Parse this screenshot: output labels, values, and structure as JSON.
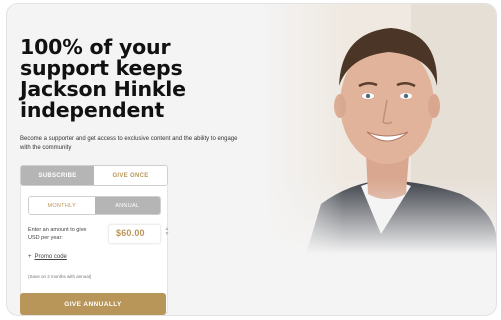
{
  "hero": {
    "headline": "100% of your support keeps Jackson Hinkle independent",
    "subtext": "Become a supporter and get access to exclusive content and the ability to engage with the community"
  },
  "tabs": [
    {
      "label": "SUBSCRIBE",
      "active": true
    },
    {
      "label": "GIVE ONCE",
      "active": false
    }
  ],
  "frequency": [
    {
      "label": "MONTHLY",
      "selected": false
    },
    {
      "label": "ANNUAL",
      "selected": true
    }
  ],
  "amount": {
    "label": "Enter an amount to give USD per year:",
    "value": "$60.00",
    "stepper_icon": "updown-chevron-icon"
  },
  "promo": {
    "plus": "+",
    "label": "Promo code"
  },
  "note": "(Save on 2 months with annual)",
  "cta": "GIVE ANNUALLY",
  "colors": {
    "accent_gold": "#b8965a",
    "tab_active_gray": "#b5b5b5",
    "card_background": "#f4f4f4"
  },
  "images": {
    "portrait": "person-portrait"
  }
}
